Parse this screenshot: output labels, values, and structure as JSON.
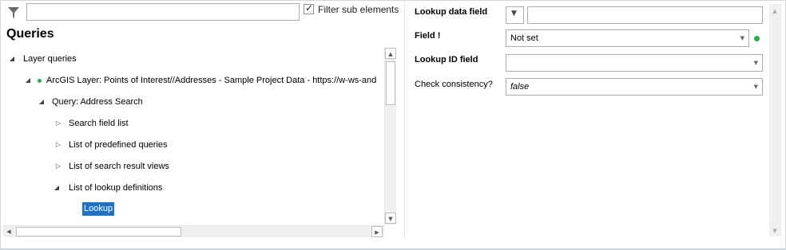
{
  "filter": {
    "input_value": "",
    "checkbox_checked": true,
    "checkbox_label": "Filter sub elements"
  },
  "tree": {
    "title": "Queries",
    "items": [
      {
        "label": "Layer queries",
        "expanded": true
      },
      {
        "label": "ArcGIS Layer: Points of Interest//Addresses - Sample Project Data - https://w-ws-and",
        "expanded": true,
        "status": "green"
      },
      {
        "label": "Query: Address Search",
        "expanded": true
      },
      {
        "label": "Search field list",
        "expanded": false
      },
      {
        "label": "List of predefined queries",
        "expanded": false
      },
      {
        "label": "List of search result views",
        "expanded": false
      },
      {
        "label": "List of lookup definitions",
        "expanded": true
      },
      {
        "label": "Lookup",
        "selected": true
      }
    ]
  },
  "properties": {
    "lookup_data_field": {
      "label": "Lookup data field",
      "value": ""
    },
    "field": {
      "label": "Field !",
      "value": "Not set",
      "status": "green"
    },
    "lookup_id_field": {
      "label": "Lookup ID field",
      "value": ""
    },
    "check_consistency": {
      "label": "Check consistency?",
      "value": "false"
    }
  }
}
